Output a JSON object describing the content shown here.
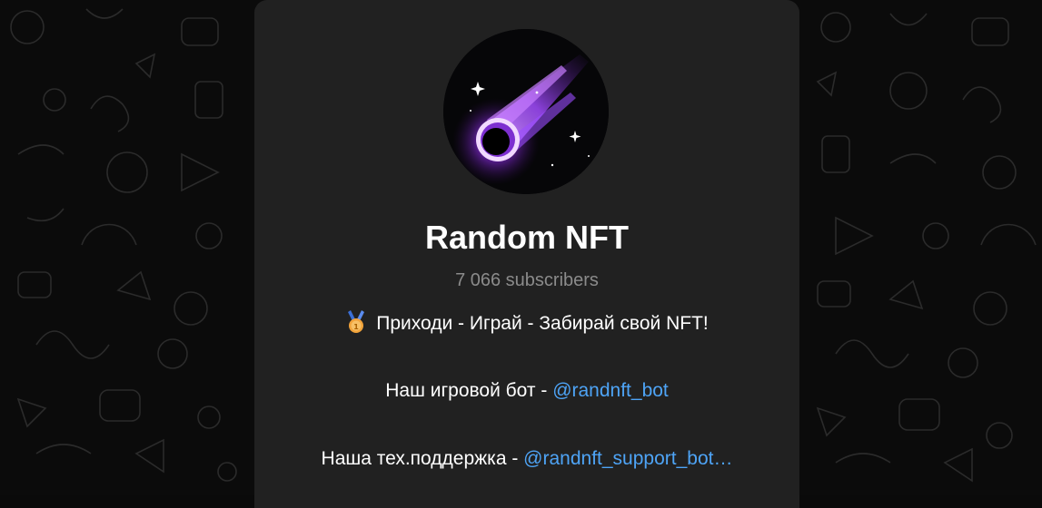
{
  "channel": {
    "title": "Random NFT",
    "subscribers": "7 066 subscribers",
    "avatar_icon": "meteor-avatar-icon"
  },
  "description": {
    "line1_icon": "medal-icon",
    "line1": "Приходи - Играй - Забирай свой NFT!",
    "line2_text": "Наш игровой бот - ",
    "line2_link": "@randnft_bot",
    "line3_text": "Наша тех.поддержка - ",
    "line3_link": "@randnft_support_bot…"
  },
  "colors": {
    "card_bg": "#212121",
    "link": "#4ea4f6",
    "muted": "#8b8b8b",
    "accent_purple": "#b455ff"
  }
}
